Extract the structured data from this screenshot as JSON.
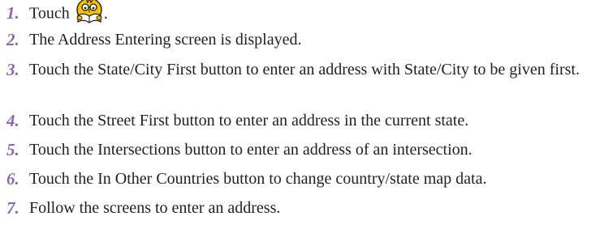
{
  "steps": [
    {
      "number": "1.",
      "text": "Touch",
      "icon": "guide-reading-book-icon",
      "suffix": "."
    },
    {
      "number": "2.",
      "text": "The Address Entering screen is displayed."
    },
    {
      "number": "3.",
      "text": "Touch the State/City First button to enter an address with State/City to be given first."
    },
    {
      "number": "4.",
      "text": "Touch the Street First button to enter an address in the current state."
    },
    {
      "number": "5.",
      "text": "Touch the Intersections button to enter an address of an intersection."
    },
    {
      "number": "6.",
      "text": "Touch the In Other Countries button to change country/state map data."
    },
    {
      "number": "7.",
      "text": "Follow the screens to enter an address."
    }
  ],
  "colors": {
    "number": "#8a68b4",
    "text": "#231f20",
    "icon_yellow": "#f5c400"
  }
}
